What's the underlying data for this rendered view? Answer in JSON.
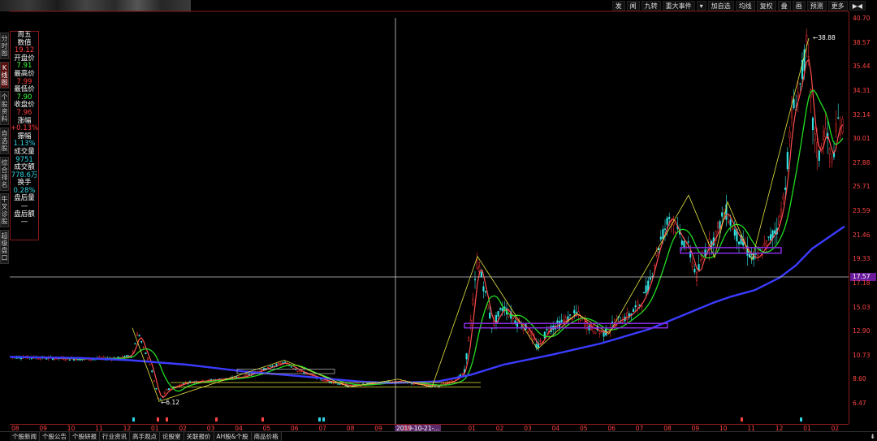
{
  "toolbar": {
    "buttons": [
      "发",
      "闻",
      "九转",
      "重大事件",
      "▾",
      "加自选",
      "均线",
      "复权",
      "叠",
      "画",
      "预测",
      "更多"
    ],
    "right_icon": "play-arrows-icon"
  },
  "left_tabs": [
    {
      "label": "分时图",
      "active": false
    },
    {
      "label": "K线图",
      "active": true
    },
    {
      "label": "个股资料",
      "active": false
    },
    {
      "label": "自选股",
      "active": false
    },
    {
      "label": "综合排名",
      "active": false
    },
    {
      "label": "牛叉诊股",
      "active": false
    },
    {
      "label": "超级盘口",
      "active": false
    }
  ],
  "info_panel": {
    "rows": [
      {
        "text": "周五",
        "color": "white"
      },
      {
        "text": "数值",
        "color": "white"
      },
      {
        "text": "19.12",
        "color": "red"
      },
      {
        "text": "开盘价",
        "color": "white"
      },
      {
        "text": "7.91",
        "color": "green"
      },
      {
        "text": "最高价",
        "color": "white"
      },
      {
        "text": "7.99",
        "color": "red"
      },
      {
        "text": "最低价",
        "color": "white"
      },
      {
        "text": "7.90",
        "color": "green"
      },
      {
        "text": "收盘价",
        "color": "white"
      },
      {
        "text": "7.96",
        "color": "red"
      },
      {
        "text": "涨幅",
        "color": "white"
      },
      {
        "text": "+0.13%",
        "color": "red"
      },
      {
        "text": "振幅",
        "color": "white"
      },
      {
        "text": "1.13%",
        "color": "cyan"
      },
      {
        "text": "成交量",
        "color": "white"
      },
      {
        "text": "9751",
        "color": "cyan"
      },
      {
        "text": "成交额",
        "color": "white"
      },
      {
        "text": "778.6万",
        "color": "cyan"
      },
      {
        "text": "换手",
        "color": "white"
      },
      {
        "text": "0.28%",
        "color": "cyan"
      },
      {
        "text": "盘后量",
        "color": "white"
      },
      {
        "text": "—",
        "color": "white"
      },
      {
        "text": "盘后额",
        "color": "white"
      },
      {
        "text": "—",
        "color": "white"
      }
    ]
  },
  "price_axis": {
    "labels": [
      "40.70",
      "38.57",
      "35.44",
      "34.31",
      "32.14",
      "30.01",
      "27.88",
      "25.71",
      "23.59",
      "21.46",
      "19.33",
      "17.18",
      "15.03",
      "12.90",
      "10.73",
      "8.60",
      "6.47"
    ],
    "current_price": "17.57"
  },
  "time_axis": {
    "labels": [
      "08",
      "09",
      "10",
      "11",
      "12",
      "01",
      "02",
      "03",
      "04",
      "05",
      "06",
      "07",
      "08",
      "09",
      "10",
      "12",
      "01",
      "02",
      "03",
      "04",
      "05",
      "06",
      "07",
      "08",
      "09",
      "10",
      "11",
      "12",
      "01",
      "02"
    ],
    "cursor_date": "2019-10-21-..."
  },
  "annotations": {
    "high_label": "38.88",
    "low_label": "6.12"
  },
  "bottom_tabs": [
    "个股新闻",
    "个股公告",
    "个股研报",
    "行业资讯",
    "高手观点",
    "论股堂",
    "关联报价",
    "AH股&个股",
    "商品价格"
  ],
  "colors": {
    "up": "#ff3333",
    "down": "#33e6e6",
    "ma_short": "#ff4d4d",
    "ma_mid": "#22dd22",
    "ma_long": "#3b3bff",
    "zigzag": "#e6e640",
    "box": "#8a2be2",
    "axis_text": "#ff4444"
  }
}
